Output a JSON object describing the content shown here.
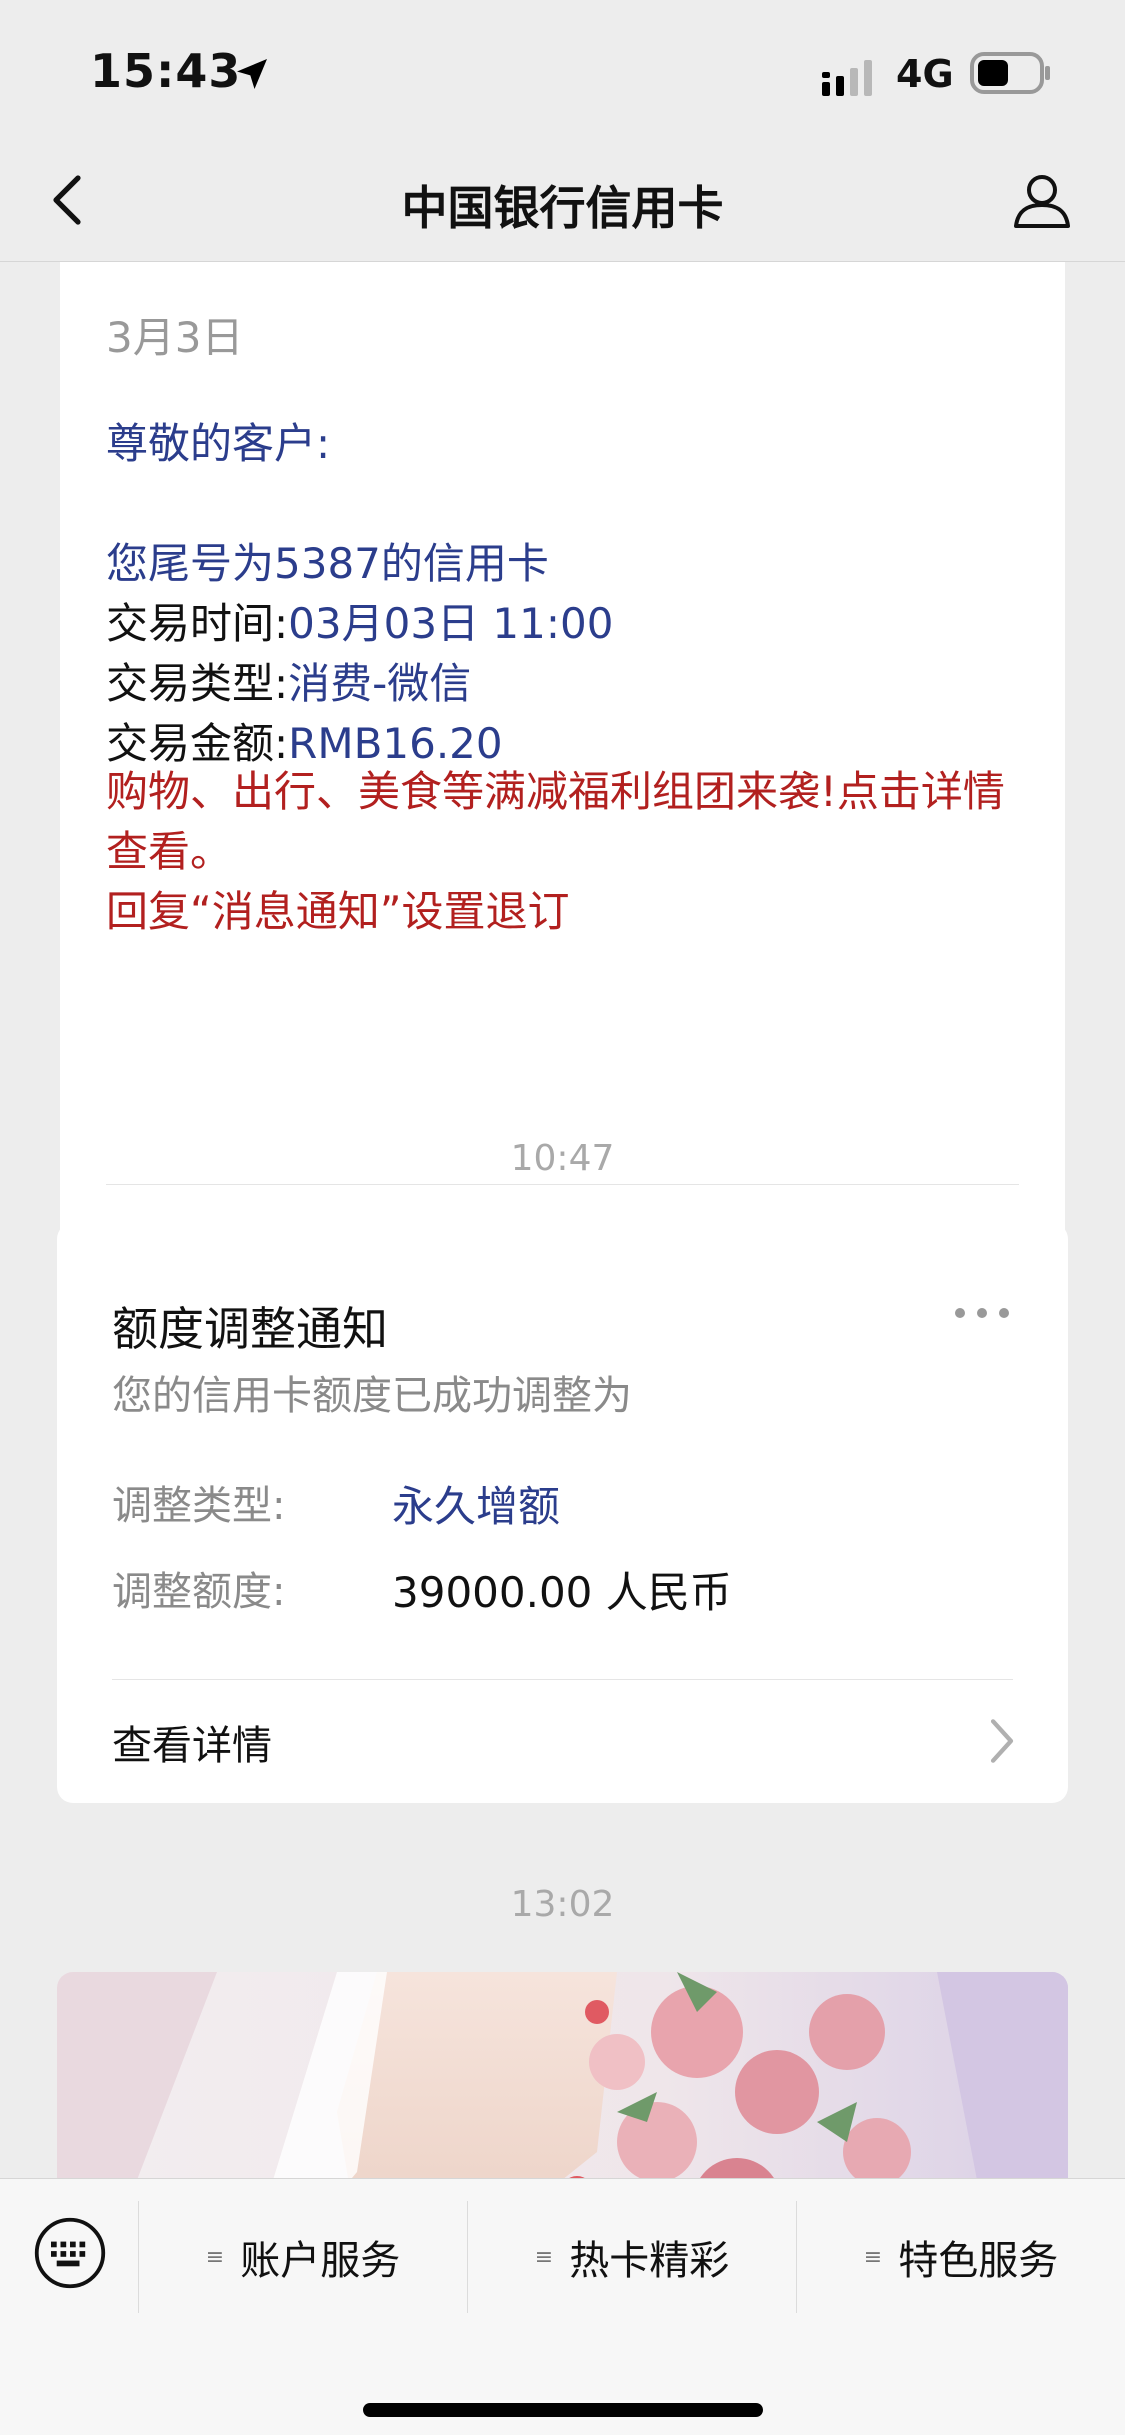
{
  "status_bar": {
    "time": "15:43",
    "network": "4G"
  },
  "nav": {
    "title": "中国银行信用卡"
  },
  "message1": {
    "date_partial": "3月3日",
    "greeting": "尊敬的客户:",
    "card_line": "您尾号为5387的信用卡",
    "rows": [
      {
        "label": "交易时间:",
        "value": "03月03日 11:00"
      },
      {
        "label": "交易类型:",
        "value": "消费-微信"
      },
      {
        "label": "交易金额:",
        "value": "RMB16.20"
      }
    ],
    "promo": "购物、出行、美食等满减福利组团来袭!点击详情查看。",
    "unsubscribe": "回复“消息通知”设置退订",
    "link": "详情"
  },
  "timestamps": [
    "10:47",
    "13:02"
  ],
  "message2": {
    "title": "额度调整通知",
    "subtitle": "您的信用卡额度已成功调整为",
    "rows": [
      {
        "label": "调整类型:",
        "value": "永久增额"
      },
      {
        "label": "调整额度:",
        "value": "39000.00 人民币"
      }
    ],
    "link": "查看详情"
  },
  "bottom_menu": {
    "items": [
      {
        "label": "账户服务"
      },
      {
        "label": "热卡精彩"
      },
      {
        "label": "特色服务"
      }
    ]
  },
  "icons": [
    "location-arrow-icon",
    "signal-icon",
    "battery-icon",
    "back-chevron-icon",
    "user-profile-icon",
    "chevron-right-icon",
    "more-dots-icon",
    "keyboard-icon",
    "menu-lines-icon"
  ],
  "colors": {
    "accent_blue": "#2b3d8c",
    "alert_red": "#b2201f",
    "background": "#ededed"
  }
}
